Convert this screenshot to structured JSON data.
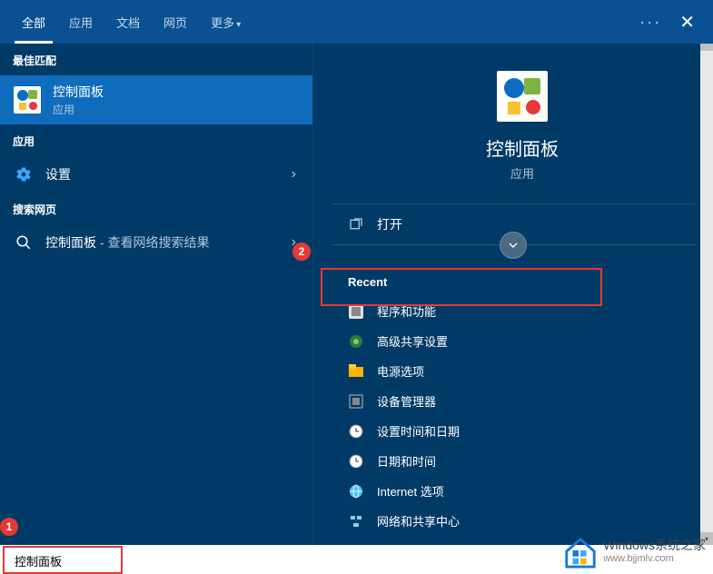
{
  "header": {
    "tabs": [
      "全部",
      "应用",
      "文档",
      "网页",
      "更多"
    ],
    "active_tab_index": 0
  },
  "left": {
    "best_match_header": "最佳匹配",
    "best_match": {
      "title": "控制面板",
      "subtitle": "应用"
    },
    "apps_header": "应用",
    "apps": [
      {
        "label": "设置"
      }
    ],
    "web_header": "搜索网页",
    "web": [
      {
        "term": "控制面板",
        "suffix": " - 查看网络搜索结果"
      }
    ]
  },
  "right": {
    "title": "控制面板",
    "subtitle": "应用",
    "actions": [
      {
        "label": "打开"
      }
    ],
    "recent_header": "Recent",
    "recent": [
      "程序和功能",
      "高级共享设置",
      "电源选项",
      "设备管理器",
      "设置时间和日期",
      "日期和时间",
      "Internet 选项",
      "网络和共享中心"
    ]
  },
  "search": {
    "value": "控制面板"
  },
  "watermark": {
    "line1": "Windows系统之家",
    "line2": "www.bjjmlv.com"
  },
  "callouts": {
    "one": "1",
    "two": "2"
  }
}
